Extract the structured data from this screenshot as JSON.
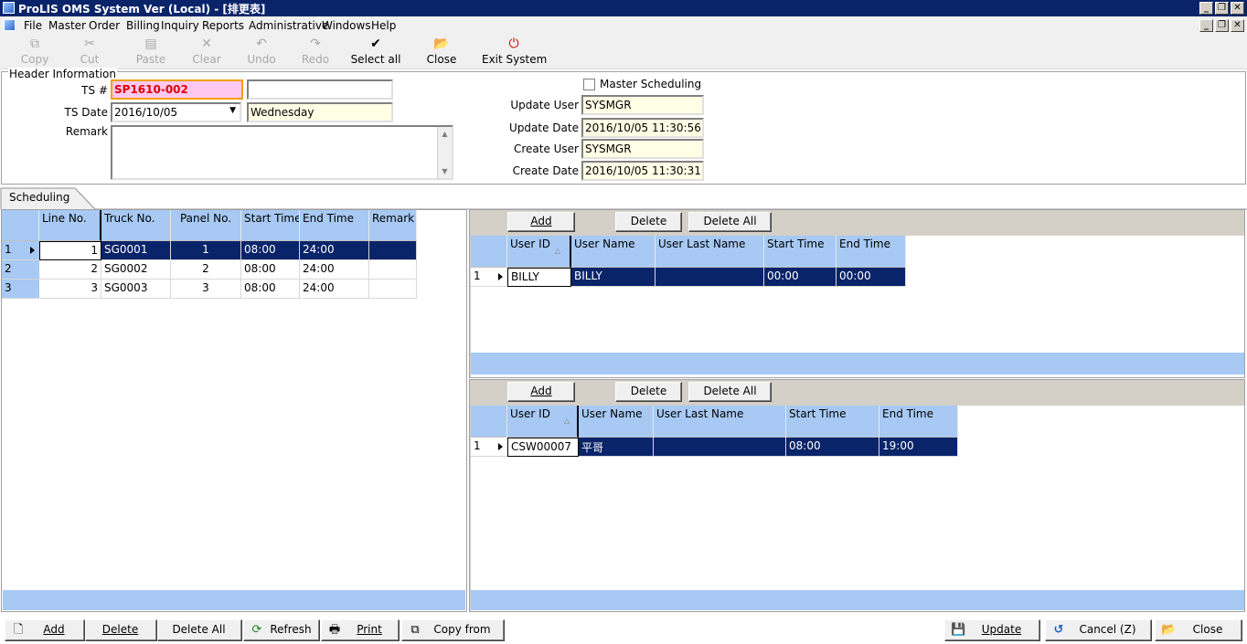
{
  "window": {
    "title": "ProLIS OMS System Ver (Local) - [排更表]"
  },
  "menu": [
    "File",
    "Master",
    "Order",
    "Billing",
    "Inquiry",
    "Reports",
    "Administrative",
    "Windows",
    "Help"
  ],
  "toolbar": {
    "copy": "Copy",
    "cut": "Cut",
    "paste": "Paste",
    "clear": "Clear",
    "undo": "Undo",
    "redo": "Redo",
    "select_all": "Select all",
    "close": "Close",
    "exit": "Exit System"
  },
  "header": {
    "legend": "Header Information",
    "ts_label": "TS #",
    "ts_value": "SP1610-002",
    "ts_extra": "",
    "date_label": "TS Date",
    "date_value": "2016/10/05",
    "weekday": "Wednesday",
    "remark_label": "Remark",
    "remark_value": "",
    "master_label": "Master Scheduling",
    "update_user_label": "Update User",
    "update_user": "SYSMGR",
    "update_date_label": "Update Date",
    "update_date": "2016/10/05 11:30:56",
    "create_user_label": "Create User",
    "create_user": "SYSMGR",
    "create_date_label": "Create Date",
    "create_date": "2016/10/05 11:30:31"
  },
  "tab": {
    "label": "Scheduling"
  },
  "schedule": {
    "columns": [
      "Line No.",
      "Truck No.",
      "Panel No.",
      "Start Time",
      "End Time",
      "Remark"
    ],
    "rows": [
      {
        "n": "1",
        "line": "1",
        "truck": "SG0001",
        "panel": "1",
        "start": "08:00",
        "end": "24:00",
        "remark": ""
      },
      {
        "n": "2",
        "line": "2",
        "truck": "SG0002",
        "panel": "2",
        "start": "08:00",
        "end": "24:00",
        "remark": ""
      },
      {
        "n": "3",
        "line": "3",
        "truck": "SG0003",
        "panel": "3",
        "start": "08:00",
        "end": "24:00",
        "remark": ""
      }
    ]
  },
  "panel1": {
    "add": "Add",
    "delete": "Delete",
    "delete_all": "Delete All",
    "columns": [
      "User ID",
      "User Name",
      "User Last Name",
      "Start Time",
      "End Time"
    ],
    "rows": [
      {
        "n": "1",
        "id": "BILLY",
        "name": "BILLY",
        "last": "",
        "start": "00:00",
        "end": "00:00"
      }
    ]
  },
  "panel2": {
    "add": "Add",
    "delete": "Delete",
    "delete_all": "Delete All",
    "columns": [
      "User ID",
      "User Name",
      "User Last Name",
      "Start Time",
      "End Time"
    ],
    "rows": [
      {
        "n": "1",
        "id": "CSW00007",
        "name": "平哥",
        "last": "",
        "start": "08:00",
        "end": "19:00"
      }
    ]
  },
  "bottom": {
    "add": "Add",
    "delete": "Delete",
    "delete_all": "Delete All",
    "refresh": "Refresh",
    "print": "Print",
    "copy_from": "Copy from",
    "update": "Update",
    "cancel": "Cancel (Z)",
    "close": "Close"
  }
}
